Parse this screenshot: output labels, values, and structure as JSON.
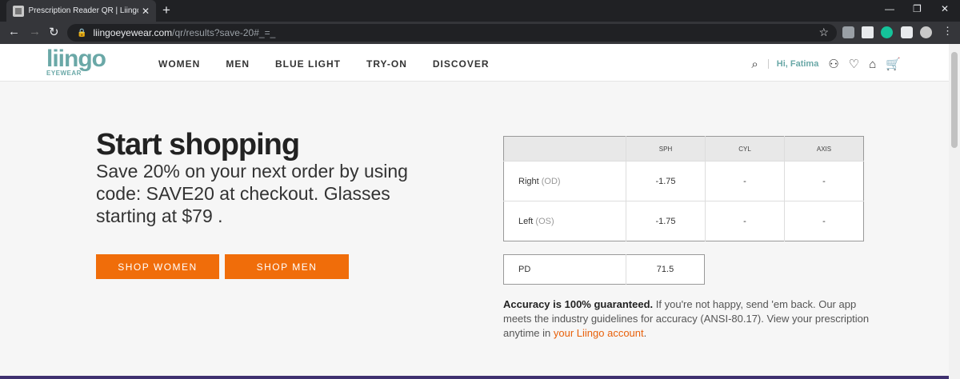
{
  "browser": {
    "tab_title": "Prescription Reader QR | Liingo E",
    "url_host": "liingoeyewear.com",
    "url_path": "/qr/results?save-20#_=_"
  },
  "header": {
    "logo_main": "liingo",
    "logo_sub": "EYEWEAR",
    "nav": [
      "WOMEN",
      "MEN",
      "BLUE LIGHT",
      "TRY-ON",
      "DISCOVER"
    ],
    "greeting": "Hi, Fatima",
    "icons": [
      "search-icon",
      "user-icon",
      "heart-icon",
      "home-icon",
      "cart-icon"
    ]
  },
  "hero": {
    "title": "Start shopping",
    "promo": "Save 20% on your next order by using code: SAVE20 at checkout. Glasses starting at $79 .",
    "shop_women": "SHOP WOMEN",
    "shop_men": "SHOP MEN",
    "button_color": "#f06d0a"
  },
  "prescription": {
    "columns": [
      "SPH",
      "CYL",
      "AXIS"
    ],
    "rows": [
      {
        "label": "Right",
        "sub": "(OD)",
        "sph": "-1.75",
        "cyl": "-",
        "axis": "-"
      },
      {
        "label": "Left",
        "sub": "(OS)",
        "sph": "-1.75",
        "cyl": "-",
        "axis": "-"
      }
    ],
    "pd_label": "PD",
    "pd_value": "71.5"
  },
  "accuracy": {
    "bold": "Accuracy is 100% guaranteed.",
    "text": " If you're not happy, send 'em back. Our app meets the industry guidelines for accuracy (ANSI-80.17). View your prescription anytime in ",
    "link": "your Liingo account",
    "end": "."
  }
}
